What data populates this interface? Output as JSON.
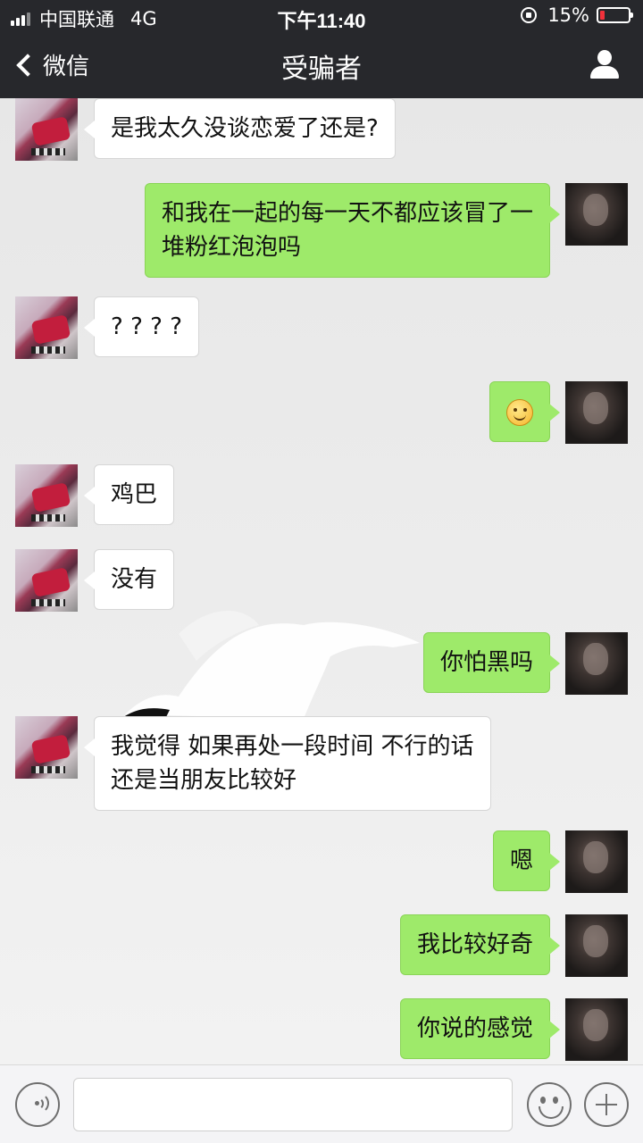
{
  "status_bar": {
    "carrier": "中国联通",
    "network": "4G",
    "time": "下午11:40",
    "battery": "15%",
    "battery_level": 0.15,
    "battery_color": "#f2313b"
  },
  "nav": {
    "back_label": "微信",
    "title": "受骗者",
    "profile_icon": "person-icon"
  },
  "colors": {
    "bubble_mine": "#9eea6a",
    "bubble_theirs": "#ffffff",
    "bar_bg": "#27282c"
  },
  "messages": [
    {
      "side": "left",
      "text": "是我太久没谈恋爱了还是?"
    },
    {
      "side": "right",
      "text": "和我在一起的每一天不都应该冒了一\n堆粉红泡泡吗"
    },
    {
      "side": "left",
      "text": "? ? ? ?"
    },
    {
      "side": "right",
      "text": "",
      "emoji": "smiley-icon"
    },
    {
      "side": "left",
      "text": "鸡巴"
    },
    {
      "side": "left",
      "text": "没有"
    },
    {
      "side": "right",
      "text": "你怕黑吗"
    },
    {
      "side": "left",
      "text": "我觉得 如果再处一段时间 不行的话\n还是当朋友比较好"
    },
    {
      "side": "right",
      "text": "嗯"
    },
    {
      "side": "right",
      "text": "我比较好奇"
    },
    {
      "side": "right",
      "text": "你说的感觉"
    }
  ],
  "input_bar": {
    "voice_icon": "voice-icon",
    "emoji_icon": "emoji-icon",
    "plus_icon": "plus-icon",
    "input_value": ""
  }
}
